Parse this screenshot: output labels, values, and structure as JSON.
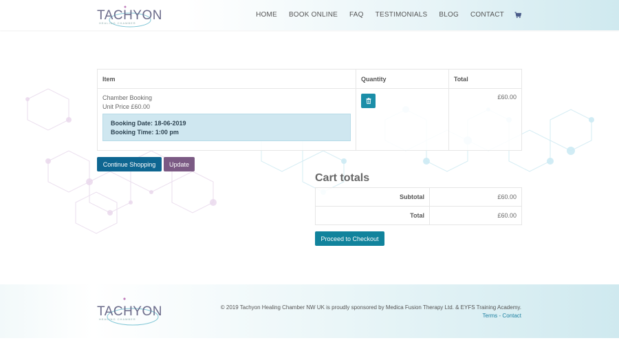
{
  "brand": {
    "name": "TACHYON",
    "tagline": "HEALING CHAMBER",
    "colors": {
      "accent_teal": "#1b8ea8",
      "accent_blue": "#0e6691",
      "accent_purple": "#7b5a84"
    }
  },
  "nav": {
    "items": [
      "HOME",
      "BOOK ONLINE",
      "FAQ",
      "TESTIMONIALS",
      "BLOG",
      "CONTACT"
    ],
    "cart_icon": "shopping-cart-icon"
  },
  "cart": {
    "headers": {
      "item": "Item",
      "quantity": "Quantity",
      "total": "Total"
    },
    "items": [
      {
        "name": "Chamber Booking",
        "unit_price": "Unit Price £60.00",
        "booking_date": "Booking Date: 18-06-2019",
        "booking_time": "Booking Time: 1:00 pm",
        "total": "£60.00",
        "delete_icon": "trash-icon"
      }
    ],
    "continue_label": "Continue Shopping",
    "update_label": "Update"
  },
  "totals": {
    "title": "Cart totals",
    "subtotal_label": "Subtotal",
    "subtotal_value": "£60.00",
    "total_label": "Total",
    "total_value": "£60.00",
    "checkout_label": "Proceed to Checkout"
  },
  "footer": {
    "copyright": "© 2019 Tachyon Healing Chamber NW UK is proudly sponsored by Medica Fusion Therapy Ltd. & EYFS Training Academy.",
    "terms": "Terms",
    "separator": " - ",
    "contact": "Contact"
  }
}
